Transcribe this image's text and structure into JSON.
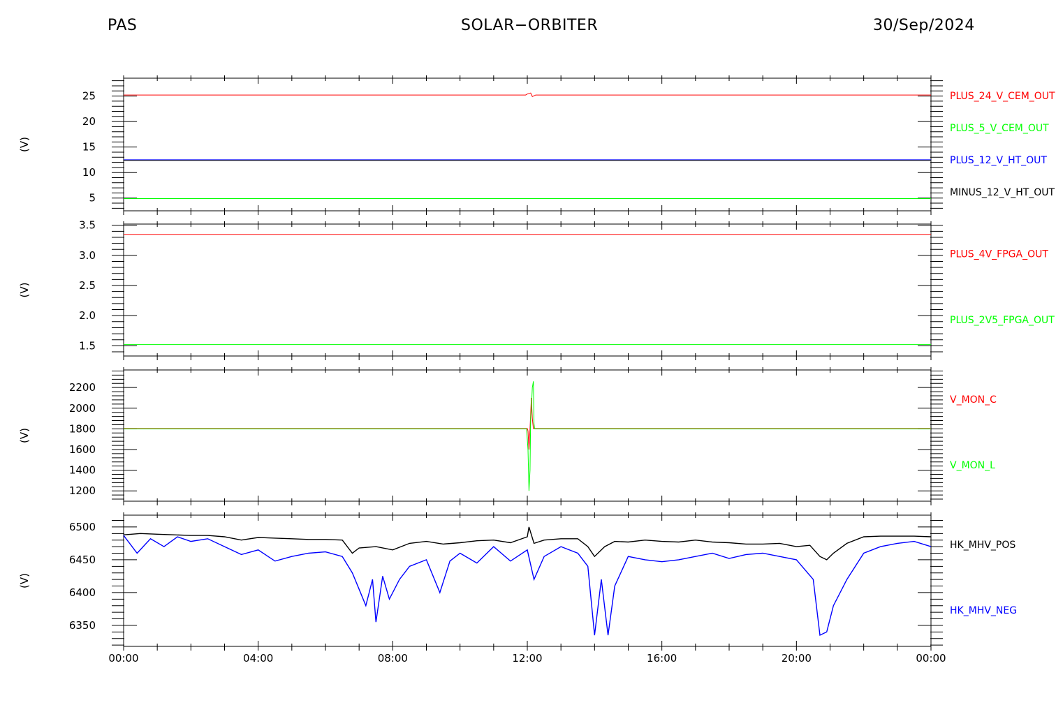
{
  "header": {
    "left": "PAS",
    "center": "SOLAR−ORBITER",
    "right": "30/Sep/2024"
  },
  "chart_data": [
    {
      "type": "line",
      "ylabel": "(V)",
      "ylim": [
        2.5,
        28.5
      ],
      "yticks": [
        5,
        10,
        15,
        20,
        25
      ],
      "x": [
        "00:00",
        "04:00",
        "08:00",
        "12:00",
        "16:00",
        "20:00",
        "00:00"
      ],
      "xlim_hours": [
        0,
        24
      ],
      "series": [
        {
          "name": "PLUS_24_V_CEM_OUT",
          "color": "#ff0000",
          "values": [
            [
              0,
              25.2
            ],
            [
              11.95,
              25.2
            ],
            [
              12.0,
              25.4
            ],
            [
              12.1,
              25.6
            ],
            [
              12.15,
              24.9
            ],
            [
              12.25,
              25.2
            ],
            [
              24,
              25.2
            ]
          ]
        },
        {
          "name": "PLUS_5_V_CEM_OUT",
          "color": "#00ff00",
          "values": [
            [
              0,
              4.9
            ],
            [
              24,
              4.9
            ]
          ]
        },
        {
          "name": "PLUS_12_V_HT_OUT",
          "color": "#0000ff",
          "values": [
            [
              0,
              12.5
            ],
            [
              24,
              12.5
            ]
          ]
        },
        {
          "name": "MINUS_12_V_HT_OUT",
          "color": "#000000",
          "values": [
            [
              0,
              12.4
            ],
            [
              24,
              12.4
            ]
          ]
        }
      ]
    },
    {
      "type": "line",
      "ylabel": "(V)",
      "ylim": [
        1.33,
        3.52
      ],
      "yticks": [
        1.5,
        2.0,
        2.5,
        3.0,
        3.5
      ],
      "x": [
        "00:00",
        "04:00",
        "08:00",
        "12:00",
        "16:00",
        "20:00",
        "00:00"
      ],
      "xlim_hours": [
        0,
        24
      ],
      "series": [
        {
          "name": "PLUS_4V_FPGA_OUT",
          "color": "#ff0000",
          "values": [
            [
              0,
              3.35
            ],
            [
              24,
              3.35
            ]
          ]
        },
        {
          "name": "PLUS_2V5_FPGA_OUT",
          "color": "#00ff00",
          "values": [
            [
              0,
              1.52
            ],
            [
              24,
              1.52
            ]
          ]
        }
      ]
    },
    {
      "type": "line",
      "ylabel": "(V)",
      "ylim": [
        1100,
        2370
      ],
      "yticks": [
        1200,
        1400,
        1600,
        1800,
        2000,
        2200
      ],
      "x": [
        "00:00",
        "04:00",
        "08:00",
        "12:00",
        "16:00",
        "20:00",
        "00:00"
      ],
      "xlim_hours": [
        0,
        24
      ],
      "series": [
        {
          "name": "V_MON_C",
          "color": "#ff0000",
          "values": [
            [
              0,
              1803
            ],
            [
              12.0,
              1803
            ],
            [
              12.02,
              1780
            ],
            [
              12.05,
              1600
            ],
            [
              12.08,
              1800
            ],
            [
              12.12,
              2100
            ],
            [
              12.15,
              1900
            ],
            [
              12.18,
              1803
            ],
            [
              24,
              1803
            ]
          ]
        },
        {
          "name": "V_MON_L",
          "color": "#00ff00",
          "values": [
            [
              0,
              1800
            ],
            [
              11.98,
              1800
            ],
            [
              12.02,
              1600
            ],
            [
              12.05,
              1200
            ],
            [
              12.08,
              1400
            ],
            [
              12.1,
              1900
            ],
            [
              12.12,
              2000
            ],
            [
              12.15,
              2200
            ],
            [
              12.18,
              2260
            ],
            [
              12.2,
              1850
            ],
            [
              12.22,
              1800
            ],
            [
              24,
              1800
            ]
          ]
        }
      ]
    },
    {
      "type": "line",
      "ylabel": "(V)",
      "ylim": [
        6318,
        6518
      ],
      "yticks": [
        6350,
        6400,
        6450,
        6500
      ],
      "x": [
        "00:00",
        "04:00",
        "08:00",
        "12:00",
        "16:00",
        "20:00",
        "00:00"
      ],
      "xlim_hours": [
        0,
        24
      ],
      "series": [
        {
          "name": "HK_MHV_POS",
          "color": "#000000",
          "values": [
            [
              0,
              6488
            ],
            [
              0.5,
              6490
            ],
            [
              1.0,
              6489
            ],
            [
              1.5,
              6488
            ],
            [
              2.0,
              6487
            ],
            [
              2.5,
              6487
            ],
            [
              3.0,
              6485
            ],
            [
              3.5,
              6480
            ],
            [
              4.0,
              6484
            ],
            [
              4.5,
              6483
            ],
            [
              5.0,
              6482
            ],
            [
              5.5,
              6481
            ],
            [
              6.0,
              6481
            ],
            [
              6.5,
              6480
            ],
            [
              6.8,
              6460
            ],
            [
              7.0,
              6468
            ],
            [
              7.5,
              6470
            ],
            [
              8.0,
              6465
            ],
            [
              8.5,
              6475
            ],
            [
              9.0,
              6478
            ],
            [
              9.5,
              6474
            ],
            [
              10.0,
              6476
            ],
            [
              10.5,
              6479
            ],
            [
              11.0,
              6480
            ],
            [
              11.5,
              6476
            ],
            [
              12.0,
              6485
            ],
            [
              12.05,
              6500
            ],
            [
              12.2,
              6475
            ],
            [
              12.5,
              6480
            ],
            [
              13.0,
              6482
            ],
            [
              13.5,
              6482
            ],
            [
              13.8,
              6470
            ],
            [
              14.0,
              6455
            ],
            [
              14.3,
              6470
            ],
            [
              14.6,
              6478
            ],
            [
              15.0,
              6477
            ],
            [
              15.5,
              6480
            ],
            [
              16.0,
              6478
            ],
            [
              16.5,
              6477
            ],
            [
              17.0,
              6480
            ],
            [
              17.5,
              6477
            ],
            [
              18.0,
              6476
            ],
            [
              18.5,
              6474
            ],
            [
              19.0,
              6474
            ],
            [
              19.5,
              6475
            ],
            [
              20.0,
              6470
            ],
            [
              20.4,
              6472
            ],
            [
              20.7,
              6455
            ],
            [
              20.9,
              6450
            ],
            [
              21.1,
              6460
            ],
            [
              21.5,
              6475
            ],
            [
              22.0,
              6485
            ],
            [
              22.5,
              6486
            ],
            [
              23.0,
              6486
            ],
            [
              23.5,
              6486
            ],
            [
              24,
              6485
            ]
          ]
        },
        {
          "name": "HK_MHV_NEG",
          "color": "#0000ff",
          "values": [
            [
              0,
              6487
            ],
            [
              0.4,
              6460
            ],
            [
              0.8,
              6482
            ],
            [
              1.2,
              6470
            ],
            [
              1.6,
              6485
            ],
            [
              2.0,
              6478
            ],
            [
              2.5,
              6482
            ],
            [
              3.0,
              6470
            ],
            [
              3.5,
              6458
            ],
            [
              4.0,
              6465
            ],
            [
              4.5,
              6448
            ],
            [
              5.0,
              6455
            ],
            [
              5.5,
              6460
            ],
            [
              6.0,
              6462
            ],
            [
              6.5,
              6455
            ],
            [
              6.8,
              6430
            ],
            [
              7.0,
              6405
            ],
            [
              7.2,
              6380
            ],
            [
              7.4,
              6420
            ],
            [
              7.5,
              6355
            ],
            [
              7.7,
              6425
            ],
            [
              7.9,
              6390
            ],
            [
              8.2,
              6420
            ],
            [
              8.5,
              6440
            ],
            [
              9.0,
              6450
            ],
            [
              9.4,
              6400
            ],
            [
              9.7,
              6448
            ],
            [
              10.0,
              6460
            ],
            [
              10.5,
              6445
            ],
            [
              11.0,
              6470
            ],
            [
              11.5,
              6448
            ],
            [
              12.0,
              6465
            ],
            [
              12.2,
              6420
            ],
            [
              12.5,
              6455
            ],
            [
              13.0,
              6470
            ],
            [
              13.5,
              6460
            ],
            [
              13.8,
              6440
            ],
            [
              14.0,
              6335
            ],
            [
              14.2,
              6420
            ],
            [
              14.4,
              6335
            ],
            [
              14.6,
              6410
            ],
            [
              15.0,
              6455
            ],
            [
              15.5,
              6450
            ],
            [
              16.0,
              6447
            ],
            [
              16.5,
              6450
            ],
            [
              17.0,
              6455
            ],
            [
              17.5,
              6460
            ],
            [
              18.0,
              6452
            ],
            [
              18.5,
              6458
            ],
            [
              19.0,
              6460
            ],
            [
              19.5,
              6455
            ],
            [
              20.0,
              6450
            ],
            [
              20.5,
              6420
            ],
            [
              20.7,
              6335
            ],
            [
              20.9,
              6340
            ],
            [
              21.1,
              6380
            ],
            [
              21.5,
              6420
            ],
            [
              22.0,
              6460
            ],
            [
              22.5,
              6470
            ],
            [
              23.0,
              6475
            ],
            [
              23.5,
              6478
            ],
            [
              24,
              6470
            ]
          ]
        }
      ]
    }
  ]
}
